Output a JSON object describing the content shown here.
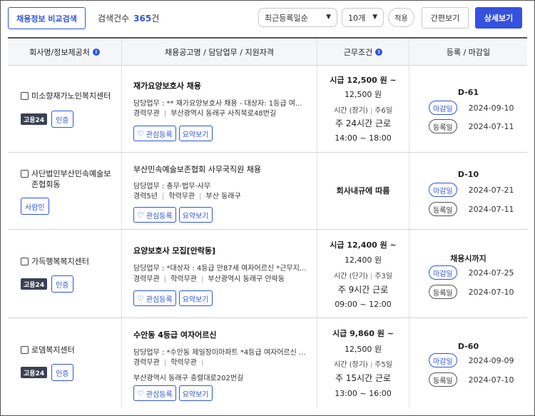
{
  "toolbar": {
    "compare_button": "채용정보 비교검색",
    "count_label": "검색건수",
    "count_value": "365",
    "count_unit": "건",
    "sort_select": "최근등록일순",
    "per_page_select": "10개",
    "apply_button": "적용",
    "simple_view_button": "간편보기",
    "detail_view_button": "상세보기"
  },
  "table": {
    "headers": [
      "회사명/정보제공처",
      "채용공고명 / 담당업무 / 지원자격",
      "근무조건",
      "등록 / 마감일"
    ]
  },
  "rows": [
    {
      "company": "미소향재가노인복지센터",
      "goyong24": "고용24",
      "cert": "인증",
      "title": "재가요양보호사 채용",
      "duty": "담당업무 : ** 재가요양보호사 채용 - 대상자: 1등급 여...",
      "career": "경력무관",
      "education": "",
      "location": "부산광역시 동래구 사직북로48번길",
      "fav": "관심등록",
      "summary": "요약보기",
      "wage1": "시급 12,500 원 ~",
      "wage2": "12,500 원",
      "worktime": "시간 (장기)",
      "workdays": "주6일",
      "weekly": "주 24시간 근로",
      "hours": "14:00 ~ 18:00",
      "dday": "D-61",
      "deadline_label": "마감일",
      "deadline": "2024-09-10",
      "reg_label": "등록일",
      "reg": "2024-07-11"
    },
    {
      "company": "사단법인부산민속예술보존협회동",
      "goyong24": "",
      "cert": "사람인",
      "title": "부산민속예술보존협회 사무국직원 채용",
      "duty": "담당업무 : 총무·법무·사무",
      "career": "경력5년",
      "education": "학력무관",
      "location": "부산 동래구",
      "fav": "관심등록",
      "summary": "요약보기",
      "wage_text": "회사내규에 따름",
      "dday": "D-10",
      "deadline_label": "마감일",
      "deadline": "2024-07-21",
      "reg_label": "등록일",
      "reg": "2024-07-11"
    },
    {
      "company": "가득행복복지센터",
      "goyong24": "고용24",
      "cert": "인증",
      "title": "요양보호사 모집[안락동]",
      "duty": "담당업무 : *대상자 : 4등급 만87세 여자어르신 *근무지...",
      "career": "경력무관",
      "education": "학력무관",
      "location": "부산광역시 동래구 안락동",
      "fav": "관심등록",
      "summary": "요약보기",
      "wage1": "시급 12,400 원 ~",
      "wage2": "12,400 원",
      "worktime": "시간 (단기)",
      "workdays": "주3일",
      "weekly": "주 9시간 근로",
      "hours": "09:00 ~ 12:00",
      "dday": "채용시까지",
      "deadline_label": "마감일",
      "deadline": "2024-07-25",
      "reg_label": "등록일",
      "reg": "2024-07-10"
    },
    {
      "company": "로뎀복지센터",
      "goyong24": "고용24",
      "cert": "인증",
      "title": "수안동 4등급 여자어르신",
      "duty": "담당업무 : *수안동 제일장미아파트 *4등급 여자어르신 ...",
      "career": "경력무관",
      "education": "학력무관",
      "location": "부산광역시 동래구 충렬대로202번길",
      "fav": "관심등록",
      "summary": "요약보기",
      "wage1": "시급 9,860 원 ~",
      "wage2": "12,500 원",
      "worktime": "시간 (장기)",
      "workdays": "주5일",
      "weekly": "주 15시간 근로",
      "hours": "13:00 ~ 16:00",
      "dday": "D-60",
      "deadline_label": "마감일",
      "deadline": "2024-09-09",
      "reg_label": "등록일",
      "reg": "2024-07-10"
    }
  ]
}
